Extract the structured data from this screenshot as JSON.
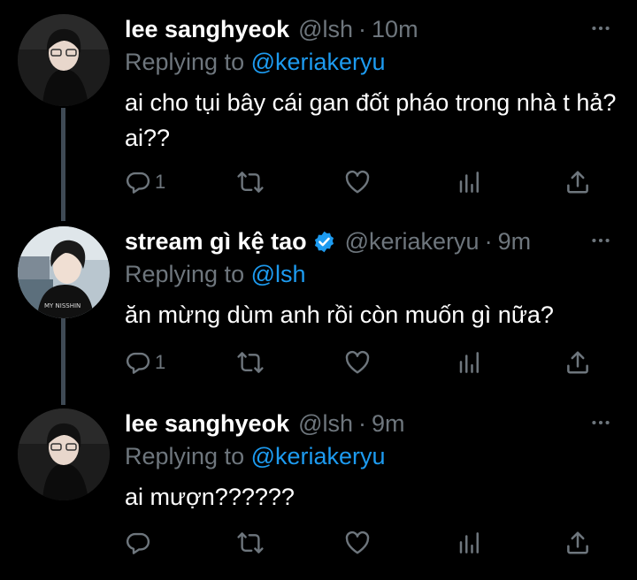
{
  "tweets": [
    {
      "name": "lee sanghyeok",
      "handle": "@lsh",
      "time": "10m",
      "replying_prefix": "Replying to",
      "replying_to": "@keriakeryu",
      "text": "ai cho tụi bây cái gan đốt pháo trong nhà t hả? ai??",
      "reply_count": "1",
      "verified": false
    },
    {
      "name": "stream gì kệ tao",
      "handle": "@keriakeryu",
      "time": "9m",
      "replying_prefix": "Replying to",
      "replying_to": "@lsh",
      "text": "ăn mừng dùm anh rồi còn muốn gì nữa?",
      "reply_count": "1",
      "verified": true
    },
    {
      "name": "lee sanghyeok",
      "handle": "@lsh",
      "time": "9m",
      "replying_prefix": "Replying to",
      "replying_to": "@keriakeryu",
      "text": "ai mượn??????",
      "reply_count": "",
      "verified": false
    }
  ],
  "separator": "·",
  "icons": {
    "reply": "reply-icon",
    "retweet": "retweet-icon",
    "like": "like-icon",
    "analytics": "analytics-icon",
    "share": "share-icon",
    "more": "more-icon",
    "verified": "verified-badge-icon"
  },
  "colors": {
    "background": "#000000",
    "text": "#ffffff",
    "muted": "#6e767d",
    "accent": "#1d9bf0",
    "thread_line": "#3f4a55"
  }
}
